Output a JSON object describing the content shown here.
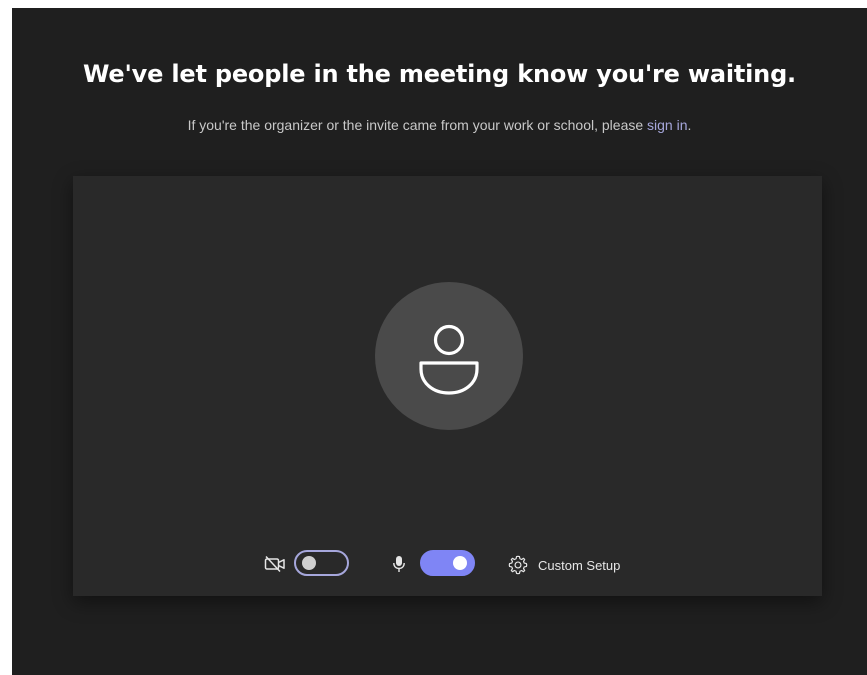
{
  "header": {
    "title": "We've let people in the meeting know you're waiting.",
    "subtitle_prefix": "If you're the organizer or the invite came from your work or school, please ",
    "sign_in_link": "sign in",
    "subtitle_suffix": "."
  },
  "preview": {
    "avatar_icon": "person-icon"
  },
  "controls": {
    "camera": {
      "icon": "camera-off-icon",
      "on": false
    },
    "microphone": {
      "icon": "microphone-icon",
      "on": true
    },
    "custom_setup": {
      "icon": "gear-icon",
      "label": "Custom Setup"
    }
  },
  "colors": {
    "background": "#1f1f1f",
    "panel": "#292929",
    "avatar": "#4a4a4a",
    "accent": "#7f85f5",
    "link": "#a6a7dc"
  }
}
